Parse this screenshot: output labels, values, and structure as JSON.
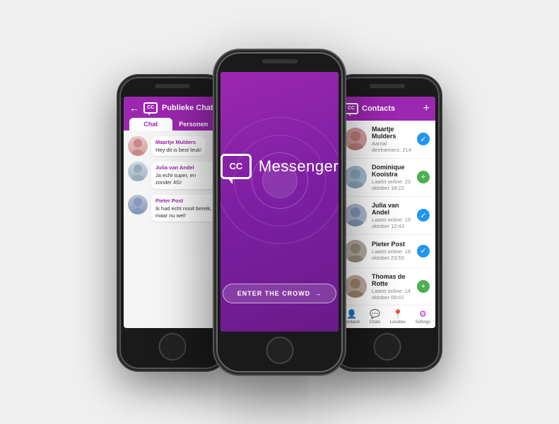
{
  "phones": {
    "left": {
      "header": {
        "title": "Publieke Chat",
        "tab_chat": "Chat",
        "tab_people": "Personen"
      },
      "messages": [
        {
          "name": "Maartje Mulders",
          "text": "Hey dit is best leuk!",
          "avatar": "av1"
        },
        {
          "name": "Julia van Andel",
          "text": "Ja echt super, en zonder 4G!",
          "avatar": "av2"
        },
        {
          "name": "Pieter Post",
          "text": "Ik had echt nooit bereik, maar nu wel!",
          "avatar": "av3"
        }
      ]
    },
    "center": {
      "title": "Messenger",
      "button": "ENTER THE CROWD",
      "button_arrow": "→"
    },
    "right": {
      "header": {
        "title": "Contacts"
      },
      "contacts": [
        {
          "name": "Maartje Mulders",
          "status": "Aantal deelnemers: 214",
          "action": "check",
          "avatar": "av1"
        },
        {
          "name": "Dominique Kooistra",
          "status": "Laatst online: 23 oktober 18:22",
          "action": "plus",
          "avatar": "av2"
        },
        {
          "name": "Julia van Andel",
          "status": "Laatst online: 19 oktober 12:43",
          "action": "check",
          "avatar": "av3"
        },
        {
          "name": "Pieter Post",
          "status": "Laatst online: 18 oktober 23:55",
          "action": "check",
          "avatar": "av4"
        },
        {
          "name": "Thomas de Rotte",
          "status": "Laatst online: 14 oktober 09:01",
          "action": "plus",
          "avatar": "av5"
        }
      ],
      "nav": [
        {
          "icon": "👤",
          "label": "Contacts"
        },
        {
          "icon": "💬",
          "label": "Chats"
        },
        {
          "icon": "📍",
          "label": "Locaties"
        },
        {
          "icon": "⚙",
          "label": "Settings"
        }
      ]
    }
  }
}
